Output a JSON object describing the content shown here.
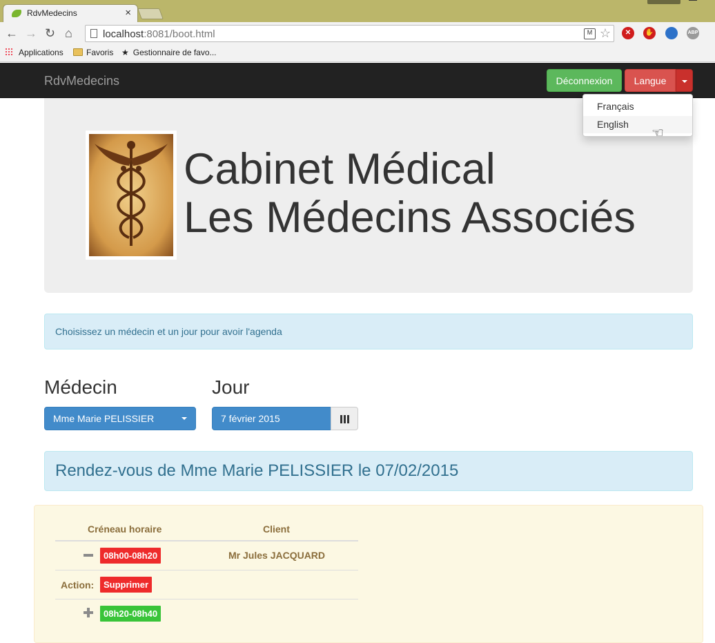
{
  "browser": {
    "tab_title": "RdvMedecins",
    "url_host": "localhost",
    "url_rest": ":8081/boot.html",
    "bookmarks": [
      "Applications",
      "Favoris",
      "Gestionnaire de favo..."
    ],
    "ext_abp": "ABP"
  },
  "navbar": {
    "brand": "RdvMedecins",
    "logout_label": "Déconnexion",
    "language_label": "Langue",
    "language_menu": [
      "Français",
      "English"
    ],
    "hovered_item": "English"
  },
  "jumbotron": {
    "title_line1": "Cabinet Médical",
    "title_line2": "Les Médecins Associés"
  },
  "info_message": "Choisissez un médecin et un jour pour avoir l'agenda",
  "form": {
    "doctor_label": "Médecin",
    "doctor_value": "Mme Marie PELISSIER",
    "day_label": "Jour",
    "day_value": "7 février 2015"
  },
  "agenda": {
    "heading": "Rendez-vous de Mme Marie PELISSIER le 07/02/2015",
    "columns": [
      "Créneau horaire",
      "Client"
    ],
    "rows": [
      {
        "slot": "08h00-08h20",
        "client": "Mr Jules JACQUARD",
        "state": "booked"
      },
      {
        "action_label": "Action:",
        "action_button": "Supprimer"
      },
      {
        "slot": "08h20-08h40",
        "client": "",
        "state": "free"
      }
    ]
  },
  "colors": {
    "navbar_bg": "#222222",
    "success": "#5cb85c",
    "danger": "#d9534f",
    "primary": "#428bca",
    "info_bg": "#d9edf7",
    "warning_bg": "#fcf8e3",
    "slot_booked": "#ee2b2b",
    "slot_free": "#39c439"
  }
}
